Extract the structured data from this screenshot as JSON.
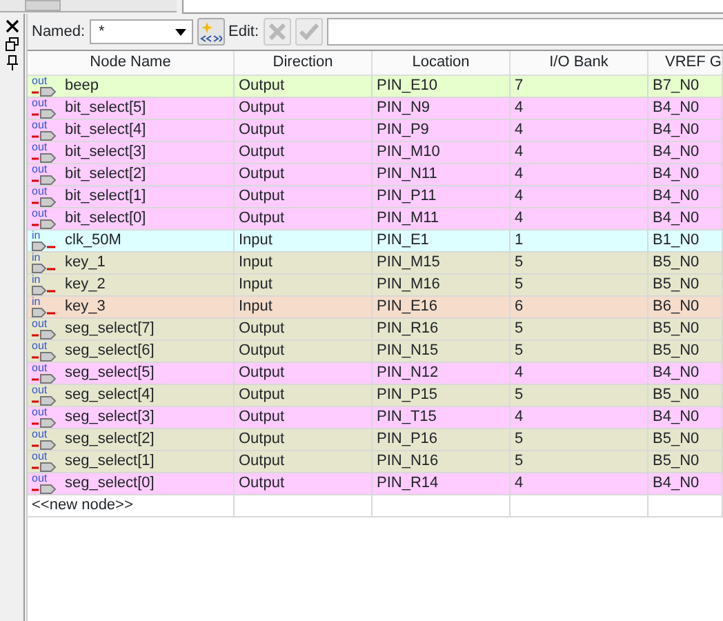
{
  "toolbar": {
    "named_label": "Named:",
    "named_value": "*",
    "edit_label": "Edit:",
    "edit_buttons": [
      {
        "kind": "cancel",
        "disabled": true
      },
      {
        "kind": "accept",
        "disabled": true
      }
    ]
  },
  "table": {
    "columns": [
      "Node Name",
      "Direction",
      "Location",
      "I/O Bank",
      "VREF G"
    ],
    "rows": [
      {
        "kind": "out",
        "icon_label": "out",
        "cells": [
          "beep",
          "Output",
          "PIN_E10",
          "7",
          "B7_N0"
        ],
        "color": "#e6ffcc"
      },
      {
        "kind": "out",
        "icon_label": "out",
        "cells": [
          "bit_select[5]",
          "Output",
          "PIN_N9",
          "4",
          "B4_N0"
        ],
        "color": "#ffccff"
      },
      {
        "kind": "out",
        "icon_label": "out",
        "cells": [
          "bit_select[4]",
          "Output",
          "PIN_P9",
          "4",
          "B4_N0"
        ],
        "color": "#ffccff"
      },
      {
        "kind": "out",
        "icon_label": "out",
        "cells": [
          "bit_select[3]",
          "Output",
          "PIN_M10",
          "4",
          "B4_N0"
        ],
        "color": "#ffccff"
      },
      {
        "kind": "out",
        "icon_label": "out",
        "cells": [
          "bit_select[2]",
          "Output",
          "PIN_N11",
          "4",
          "B4_N0"
        ],
        "color": "#ffccff"
      },
      {
        "kind": "out",
        "icon_label": "out",
        "cells": [
          "bit_select[1]",
          "Output",
          "PIN_P11",
          "4",
          "B4_N0"
        ],
        "color": "#ffccff"
      },
      {
        "kind": "out",
        "icon_label": "out",
        "cells": [
          "bit_select[0]",
          "Output",
          "PIN_M11",
          "4",
          "B4_N0"
        ],
        "color": "#ffccff"
      },
      {
        "kind": "in",
        "icon_label": "in",
        "cells": [
          "clk_50M",
          "Input",
          "PIN_E1",
          "1",
          "B1_N0"
        ],
        "color": "#ddffff"
      },
      {
        "kind": "in",
        "icon_label": "in",
        "cells": [
          "key_1",
          "Input",
          "PIN_M15",
          "5",
          "B5_N0"
        ],
        "color": "#e6e6cc"
      },
      {
        "kind": "in",
        "icon_label": "in",
        "cells": [
          "key_2",
          "Input",
          "PIN_M16",
          "5",
          "B5_N0"
        ],
        "color": "#e6e6cc"
      },
      {
        "kind": "in",
        "icon_label": "in",
        "cells": [
          "key_3",
          "Input",
          "PIN_E16",
          "6",
          "B6_N0"
        ],
        "color": "#f5dccb"
      },
      {
        "kind": "out",
        "icon_label": "out",
        "cells": [
          "seg_select[7]",
          "Output",
          "PIN_R16",
          "5",
          "B5_N0"
        ],
        "color": "#e6e6cc"
      },
      {
        "kind": "out",
        "icon_label": "out",
        "cells": [
          "seg_select[6]",
          "Output",
          "PIN_N15",
          "5",
          "B5_N0"
        ],
        "color": "#e6e6cc"
      },
      {
        "kind": "out",
        "icon_label": "out",
        "cells": [
          "seg_select[5]",
          "Output",
          "PIN_N12",
          "4",
          "B4_N0"
        ],
        "color": "#ffccff"
      },
      {
        "kind": "out",
        "icon_label": "out",
        "cells": [
          "seg_select[4]",
          "Output",
          "PIN_P15",
          "5",
          "B5_N0"
        ],
        "color": "#e6e6cc"
      },
      {
        "kind": "out",
        "icon_label": "out",
        "cells": [
          "seg_select[3]",
          "Output",
          "PIN_T15",
          "4",
          "B4_N0"
        ],
        "color": "#ffccff"
      },
      {
        "kind": "out",
        "icon_label": "out",
        "cells": [
          "seg_select[2]",
          "Output",
          "PIN_P16",
          "5",
          "B5_N0"
        ],
        "color": "#e6e6cc"
      },
      {
        "kind": "out",
        "icon_label": "out",
        "cells": [
          "seg_select[1]",
          "Output",
          "PIN_N16",
          "5",
          "B5_N0"
        ],
        "color": "#e6e6cc"
      },
      {
        "kind": "out",
        "icon_label": "out",
        "cells": [
          "seg_select[0]",
          "Output",
          "PIN_R14",
          "4",
          "B4_N0"
        ],
        "color": "#ffccff"
      }
    ],
    "new_row": "<<new node>>"
  }
}
